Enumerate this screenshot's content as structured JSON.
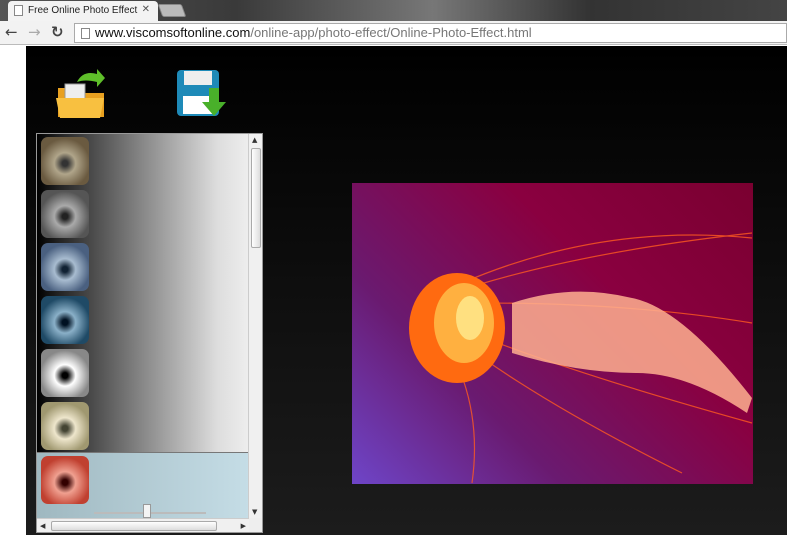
{
  "browser": {
    "tab_title": "Free Online Photo Effect",
    "url_host": "www.viscomsoftonline.com",
    "url_path": "/online-app/photo-effect/Online-Photo-Effect.html"
  },
  "toolbar": {
    "icons": [
      "open-folder-icon",
      "save-download-icon"
    ]
  },
  "effects": {
    "thumbnails": [
      {
        "name": "original",
        "color": "#9a8a70"
      },
      {
        "name": "grayscale",
        "color": "#808080"
      },
      {
        "name": "blue-tint",
        "color": "#7890a8"
      },
      {
        "name": "cyan-tone",
        "color": "#3f6d86"
      },
      {
        "name": "high-contrast",
        "color": "#dedbd0"
      },
      {
        "name": "sepia-light",
        "color": "#d8cfb0"
      },
      {
        "name": "red-tint",
        "color": "#e06a5a"
      }
    ],
    "selected_index": 6
  },
  "preview": {
    "subject": "jellyfish",
    "accent": "#ff7a1a"
  }
}
